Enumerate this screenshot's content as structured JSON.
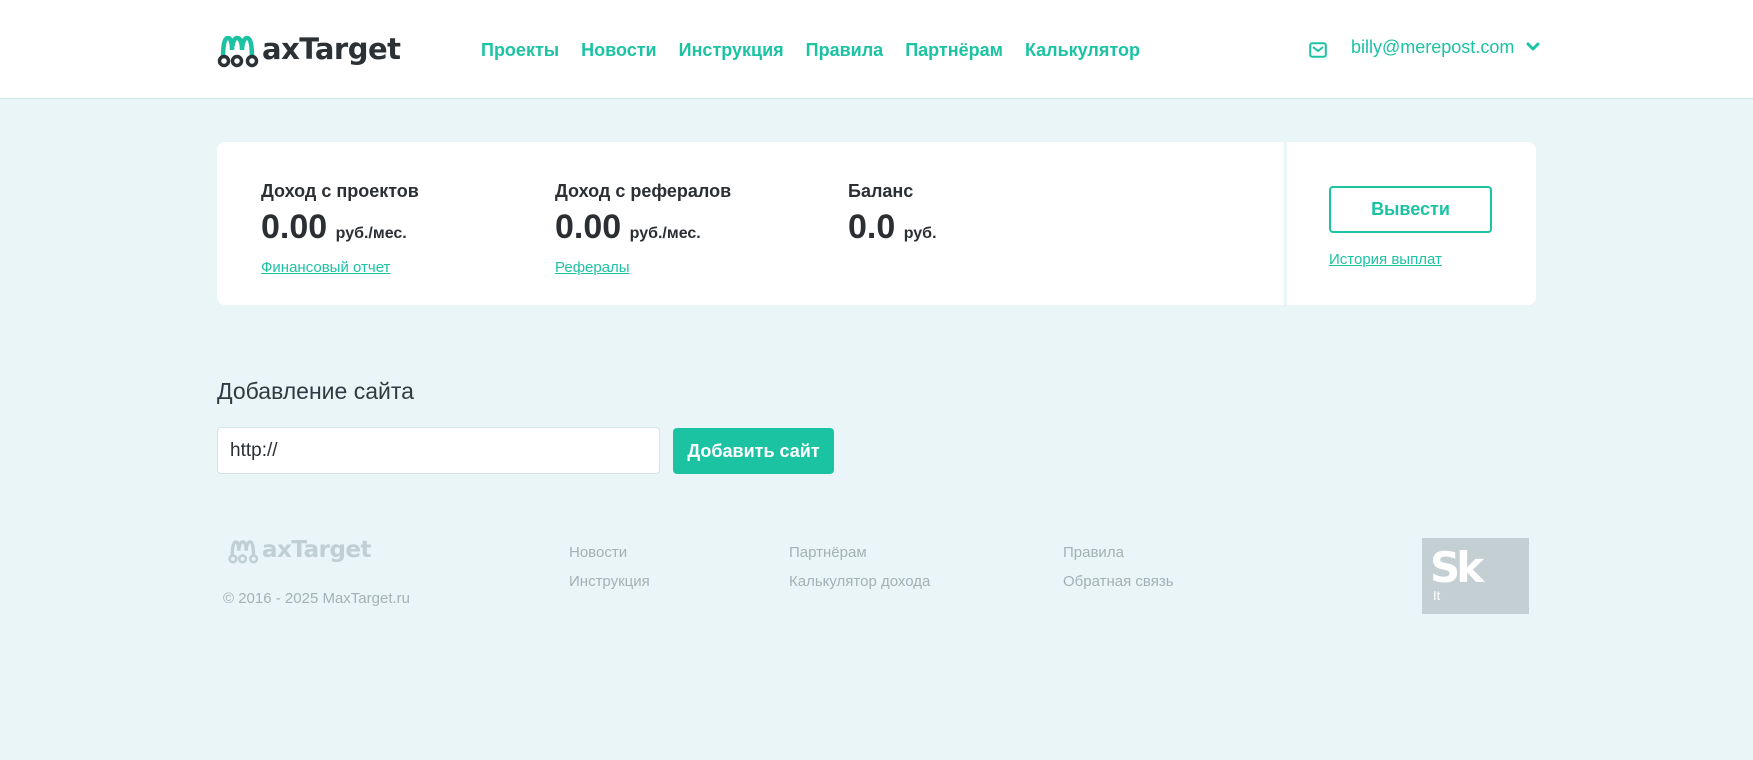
{
  "header": {
    "logo_text": "axTarget",
    "nav": [
      "Проекты",
      "Новости",
      "Инструкция",
      "Правила",
      "Партнёрам",
      "Калькулятор"
    ],
    "user_email": "billy@merepost.com",
    "icons": {
      "mail": "mail-icon",
      "dropdown": "chevron-down-icon"
    }
  },
  "stats": {
    "projects": {
      "label": "Доход с проектов",
      "value": "0.00",
      "unit": "руб./мес.",
      "link": "Финансовый отчет"
    },
    "referrals": {
      "label": "Доход с рефералов",
      "value": "0.00",
      "unit": "руб./мес.",
      "link": "Рефералы"
    },
    "balance": {
      "label": "Баланс",
      "value": "0.0",
      "unit": "руб."
    },
    "withdraw_label": "Вывести",
    "payout_history_link": "История выплат"
  },
  "add_site": {
    "title": "Добавление сайта",
    "input_value": "http://",
    "button_label": "Добавить сайт"
  },
  "footer": {
    "logo_text": "axTarget",
    "copyright": "© 2016 - 2025 MaxTarget.ru",
    "col1": [
      "Новости",
      "Инструкция"
    ],
    "col2": [
      "Партнёрам",
      "Калькулятор дохода"
    ],
    "col3": [
      "Правила",
      "Обратная связь"
    ],
    "badge_text": "Sk",
    "badge_sub": "It"
  },
  "colors": {
    "accent": "#1cc3a2",
    "background": "#e9f5f6",
    "text": "#2b2f33",
    "footer_text": "#a3b2b6"
  }
}
